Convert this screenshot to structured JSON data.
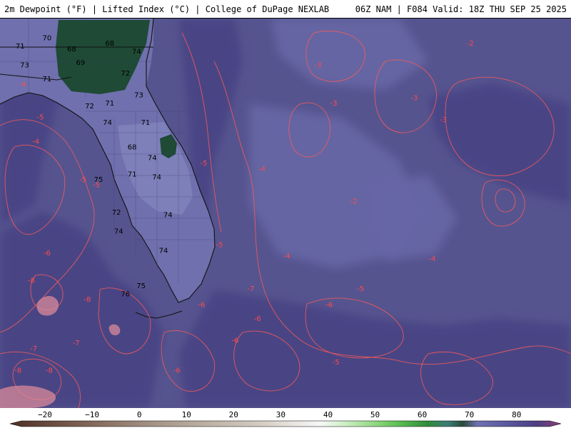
{
  "header": {
    "left_title": "2m Dewpoint (°F) | Lifted Index (°C) | College of DuPage NEXLAB",
    "right_title": "06Z NAM | F084 Valid: 18Z THU SEP 25 2025"
  },
  "colors": {
    "ocean": "#56548f",
    "ocean_light": "#6766a5",
    "ocean_dark": "#4a4585",
    "land": "#6f70ad",
    "land_light": "#8587bf",
    "moist_green": "#1f4a36",
    "contour": "#ff5a55",
    "coast": "#111111",
    "label_pink": "#ff4a4a"
  },
  "map_labels": {
    "dewpoint": [
      {
        "text": "71",
        "lon": -86.6,
        "lat": 30.7
      },
      {
        "text": "70",
        "lon": -85.4,
        "lat": 31.0
      },
      {
        "text": "73",
        "lon": -86.4,
        "lat": 30.0
      },
      {
        "text": "68",
        "lon": -84.3,
        "lat": 30.6
      },
      {
        "text": "68",
        "lon": -82.6,
        "lat": 30.8
      },
      {
        "text": "69",
        "lon": -83.9,
        "lat": 30.1
      },
      {
        "text": "74",
        "lon": -81.4,
        "lat": 30.5
      },
      {
        "text": "71",
        "lon": -85.4,
        "lat": 29.5
      },
      {
        "text": "72",
        "lon": -81.9,
        "lat": 29.7
      },
      {
        "text": "73",
        "lon": -81.3,
        "lat": 28.9
      },
      {
        "text": "71",
        "lon": -82.6,
        "lat": 28.6
      },
      {
        "text": "72",
        "lon": -83.5,
        "lat": 28.5
      },
      {
        "text": "74",
        "lon": -82.7,
        "lat": 27.9
      },
      {
        "text": "71",
        "lon": -81.0,
        "lat": 27.9
      },
      {
        "text": "68",
        "lon": -81.6,
        "lat": 27.0
      },
      {
        "text": "74",
        "lon": -80.7,
        "lat": 26.6
      },
      {
        "text": "71",
        "lon": -81.6,
        "lat": 26.0
      },
      {
        "text": "74",
        "lon": -80.5,
        "lat": 25.9
      },
      {
        "text": "75",
        "lon": -83.1,
        "lat": 25.8
      },
      {
        "text": "72",
        "lon": -82.3,
        "lat": 24.6
      },
      {
        "text": "74",
        "lon": -80.0,
        "lat": 24.5
      },
      {
        "text": "74",
        "lon": -82.2,
        "lat": 23.9
      },
      {
        "text": "74",
        "lon": -80.2,
        "lat": 23.2
      },
      {
        "text": "75",
        "lon": -81.2,
        "lat": 21.9
      },
      {
        "text": "76",
        "lon": -81.9,
        "lat": 21.6
      }
    ],
    "lifted_index": [
      {
        "text": "-4",
        "lon": -86.5,
        "lat": 29.3
      },
      {
        "text": "-5",
        "lon": -85.7,
        "lat": 28.1
      },
      {
        "text": "-4",
        "lon": -85.9,
        "lat": 27.2
      },
      {
        "text": "-5",
        "lon": -83.8,
        "lat": 25.8
      },
      {
        "text": "-5",
        "lon": -83.2,
        "lat": 25.6
      },
      {
        "text": "-6",
        "lon": -85.4,
        "lat": 23.1
      },
      {
        "text": "-8",
        "lon": -86.1,
        "lat": 22.1
      },
      {
        "text": "-8",
        "lon": -83.6,
        "lat": 21.4
      },
      {
        "text": "-7",
        "lon": -86.0,
        "lat": 19.6
      },
      {
        "text": "-7",
        "lon": -84.1,
        "lat": 19.8
      },
      {
        "text": "-8",
        "lon": -86.7,
        "lat": 18.8
      },
      {
        "text": "-8",
        "lon": -85.3,
        "lat": 18.8
      },
      {
        "text": "-5",
        "lon": -78.4,
        "lat": 26.4
      },
      {
        "text": "-4",
        "lon": -75.8,
        "lat": 26.2
      },
      {
        "text": "-5",
        "lon": -77.7,
        "lat": 23.4
      },
      {
        "text": "-4",
        "lon": -74.7,
        "lat": 23.0
      },
      {
        "text": "-7",
        "lon": -76.3,
        "lat": 21.8
      },
      {
        "text": "-6",
        "lon": -78.5,
        "lat": 21.2
      },
      {
        "text": "-6",
        "lon": -72.8,
        "lat": 21.2
      },
      {
        "text": "-6",
        "lon": -76.0,
        "lat": 20.7
      },
      {
        "text": "-6",
        "lon": -77.0,
        "lat": 19.9
      },
      {
        "text": "-6",
        "lon": -79.6,
        "lat": 18.8
      },
      {
        "text": "-5",
        "lon": -72.5,
        "lat": 19.1
      },
      {
        "text": "-5",
        "lon": -71.4,
        "lat": 21.8
      },
      {
        "text": "-3",
        "lon": -73.3,
        "lat": 30.0
      },
      {
        "text": "-3",
        "lon": -72.6,
        "lat": 28.6
      },
      {
        "text": "-3",
        "lon": -69.0,
        "lat": 28.8
      },
      {
        "text": "-2",
        "lon": -66.5,
        "lat": 30.8
      },
      {
        "text": "-3",
        "lon": -67.7,
        "lat": 28.0
      },
      {
        "text": "-2",
        "lon": -71.7,
        "lat": 25.0
      },
      {
        "text": "-4",
        "lon": -68.2,
        "lat": 22.9
      }
    ]
  },
  "colorbar": {
    "ticks": [
      {
        "label": "−20",
        "value": -20
      },
      {
        "label": "−10",
        "value": -10
      },
      {
        "label": "0",
        "value": 0
      },
      {
        "label": "10",
        "value": 10
      },
      {
        "label": "20",
        "value": 20
      },
      {
        "label": "30",
        "value": 30
      },
      {
        "label": "40",
        "value": 40
      },
      {
        "label": "50",
        "value": 50
      },
      {
        "label": "60",
        "value": 60
      },
      {
        "label": "70",
        "value": 70
      },
      {
        "label": "80",
        "value": 80
      }
    ],
    "range": [
      -25,
      87
    ],
    "stops": [
      {
        "value": -25,
        "color": "#4d2f25"
      },
      {
        "value": -15,
        "color": "#6f5246"
      },
      {
        "value": -5,
        "color": "#8c7466"
      },
      {
        "value": 5,
        "color": "#a69688"
      },
      {
        "value": 15,
        "color": "#bdb1a4"
      },
      {
        "value": 25,
        "color": "#d2cabf"
      },
      {
        "value": 32,
        "color": "#e6e2dc"
      },
      {
        "value": 38,
        "color": "#f7f7f7"
      },
      {
        "value": 42,
        "color": "#d6f2cf"
      },
      {
        "value": 48,
        "color": "#9fdc8e"
      },
      {
        "value": 54,
        "color": "#5cbf52"
      },
      {
        "value": 60,
        "color": "#2f8a3b"
      },
      {
        "value": 64,
        "color": "#3c7d78"
      },
      {
        "value": 67,
        "color": "#2a4a3a"
      },
      {
        "value": 70,
        "color": "#6f71b0"
      },
      {
        "value": 76,
        "color": "#5a58a0"
      },
      {
        "value": 82,
        "color": "#4c3e83"
      },
      {
        "value": 87,
        "color": "#8a3e78"
      }
    ]
  }
}
